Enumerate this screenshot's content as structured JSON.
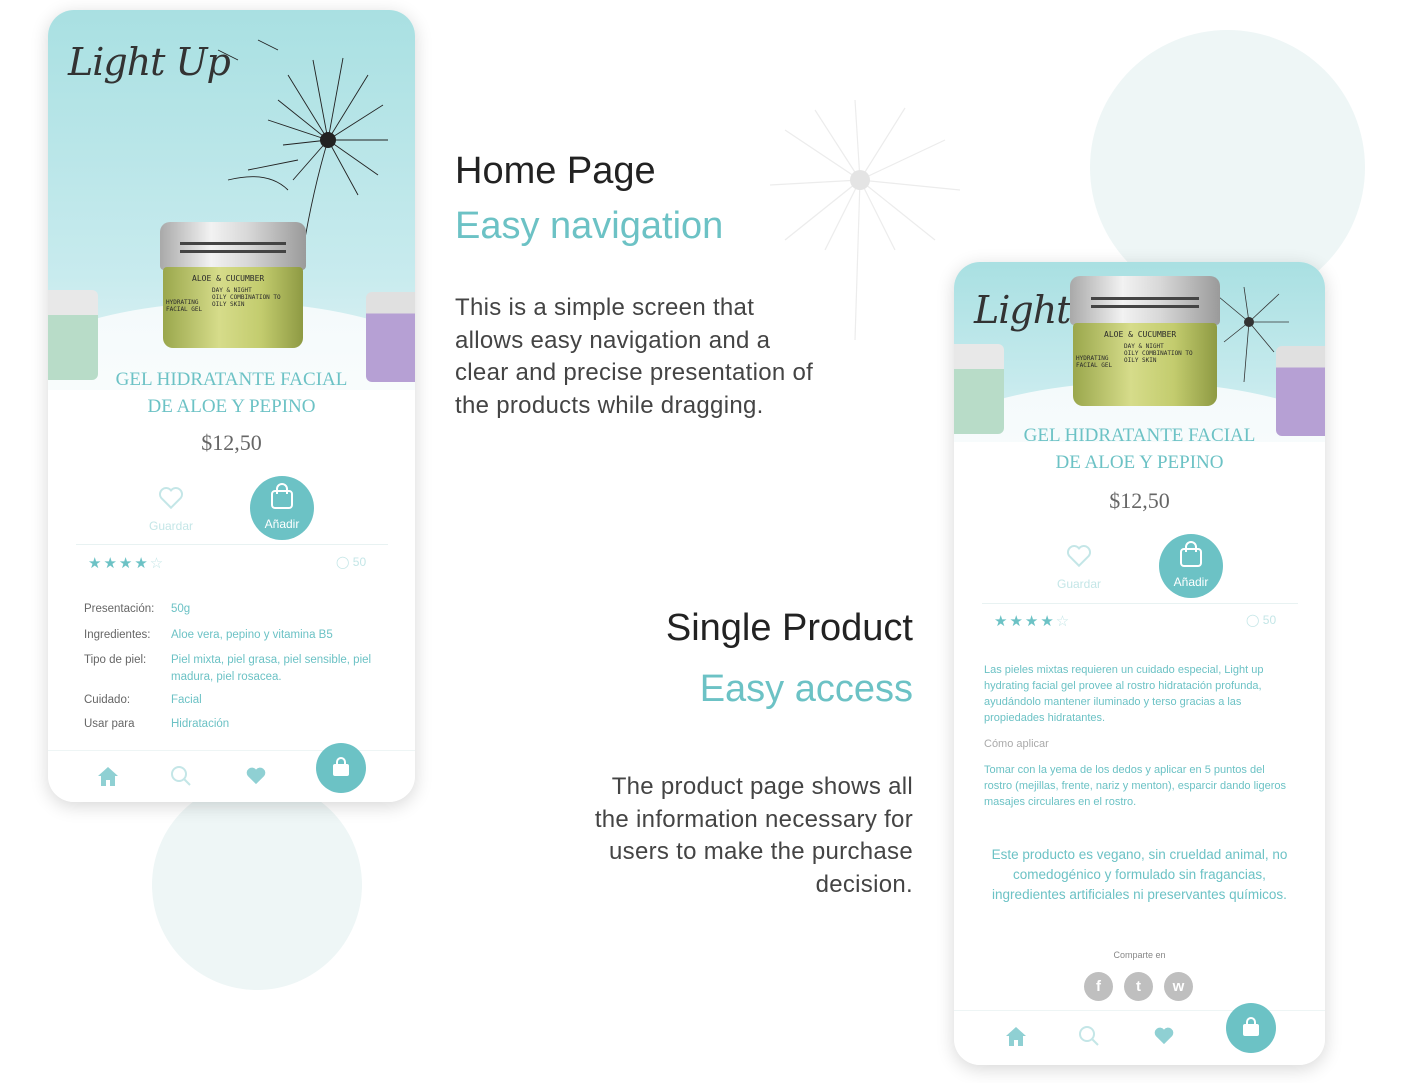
{
  "sections": {
    "home": {
      "title": "Home Page",
      "subtitle": "Easy navigation",
      "body": "This is a simple screen that allows easy navigation and a clear and precise presentation of the products while dragging."
    },
    "single": {
      "title": "Single Product",
      "subtitle": "Easy access",
      "body": "The product page shows all the information necessary for users to make the purchase decision."
    }
  },
  "brand": {
    "logo": "Light Up"
  },
  "jar": {
    "label_title": "ALOE & CUCUMBER",
    "label_lines": "DAY & NIGHT\nOILY COMBINATION TO\nOILY SKIN",
    "label_side": "HYDRATING\nFACIAL GEL"
  },
  "product": {
    "name_line1": "GEL HIDRATANTE FACIAL",
    "name_line2": "DE ALOE Y PEPINO",
    "price": "$12,50",
    "save_label": "Guardar",
    "add_label": "Añadir",
    "rating": 4,
    "rating_max": 5,
    "comments_count": "50"
  },
  "specs": [
    {
      "key": "Presentación:",
      "value": "50g"
    },
    {
      "key": "Ingredientes:",
      "value": "Aloe vera, pepino y vitamina B5"
    },
    {
      "key": "Tipo de piel:",
      "value": "Piel mixta, piel grasa, piel sensible, piel madura, piel rosacea."
    },
    {
      "key": "Cuidado:",
      "value": "Facial"
    },
    {
      "key": "Usar para",
      "value": "Hidratación"
    }
  ],
  "detail": {
    "description": "Las pieles mixtas requieren un cuidado especial, Light up hydrating facial gel provee al rostro hidratación profunda, ayudándolo mantener iluminado y terso gracias a las propiedades hidratantes.",
    "how_title": "Cómo aplicar",
    "how_text": "Tomar con la yema de los dedos y aplicar en 5 puntos del rostro (mejillas, frente, nariz y menton), esparcir dando ligeros masajes circulares en el rostro.",
    "vegan": "Este producto es vegano, sin crueldad animal, no comedogénico y formulado sin fragancias, ingredientes artificiales ni preservantes químicos.",
    "share_label": "Comparte en"
  },
  "social": [
    "facebook-icon",
    "twitter-icon",
    "whatsapp-icon"
  ],
  "nav": [
    "home-icon",
    "search-icon",
    "heart-icon",
    "cart-icon"
  ],
  "colors": {
    "accent": "#6cc2c5",
    "accent_light": "#c4e6e7",
    "hero": "#a9e0e2"
  }
}
